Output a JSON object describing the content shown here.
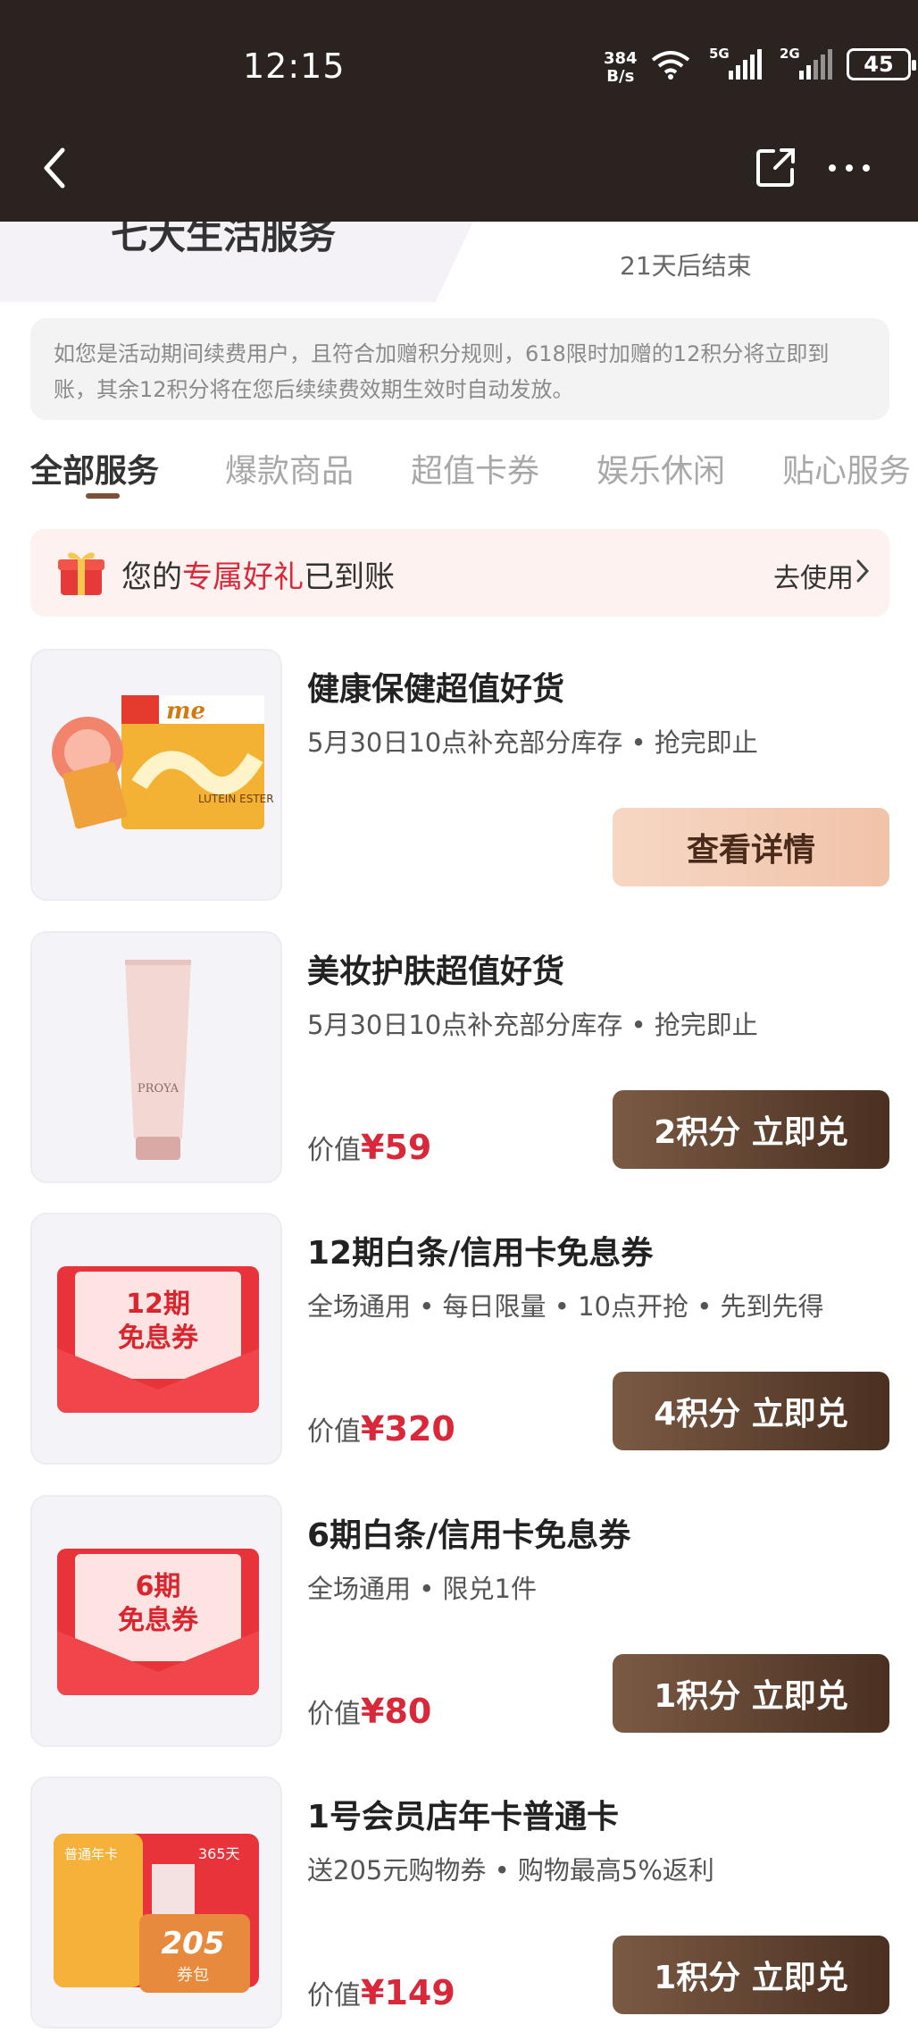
{
  "status_bar": {
    "time": "12:15",
    "net_speed_value": "384",
    "net_speed_unit": "B/s",
    "sim1_label": "5G",
    "sim2_label": "2G",
    "battery": "45"
  },
  "header": {
    "section_title": "七大生活服务",
    "countdown": "21天后结束"
  },
  "notice": "如您是活动期间续费用户，且符合加赠积分规则，618限时加赠的12积分将立即到账，其余12积分将在您后续续费效期生效时自动发放。",
  "tabs": [
    {
      "label": "全部服务"
    },
    {
      "label": "爆款商品"
    },
    {
      "label": "超值卡券"
    },
    {
      "label": "娱乐休闲"
    },
    {
      "label": "贴心服务"
    }
  ],
  "gift_banner": {
    "prefix": "您的",
    "highlight": "专属好礼",
    "suffix": "已到账",
    "action": "去使用"
  },
  "items": [
    {
      "title": "健康保健超值好货",
      "desc": "5月30日10点补充部分库存 • 抢完即止",
      "price_prefix": "",
      "price": "",
      "button": "查看详情"
    },
    {
      "title": "美妆护肤超值好货",
      "desc": "5月30日10点补充部分库存 • 抢完即止",
      "price_prefix": "价值",
      "price": "¥59",
      "button": "2积分 立即兑"
    },
    {
      "title": "12期白条/信用卡免息券",
      "desc": "全场通用 • 每日限量 • 10点开抢 • 先到先得",
      "price_prefix": "价值",
      "price": "¥320",
      "button": "4积分 立即兑"
    },
    {
      "title": "6期白条/信用卡免息券",
      "desc": "全场通用 • 限兑1件",
      "price_prefix": "价值",
      "price": "¥80",
      "button": "1积分 立即兑"
    },
    {
      "title": "1号会员店年卡普通卡",
      "desc": "送205元购物券 • 购物最高5%返利",
      "price_prefix": "价值",
      "price": "¥149",
      "button": "1积分 立即兑"
    }
  ],
  "thumbs": {
    "product1_brand": "me",
    "product1_box_text": "LUTEIN ESTER",
    "product2_brand": "PROYA",
    "coupon12_line1": "12期",
    "coupon12_line2": "免息券",
    "coupon6_line1": "6期",
    "coupon6_line2": "免息券",
    "card_label": "普通年卡",
    "card_days": "365天",
    "card_voucher": "205",
    "card_voucher_label": "券包"
  },
  "colors": {
    "topbar": "#2b2320",
    "accent_red": "#d8283a",
    "button_dark": "#5a3b2a",
    "button_light": "#f3cbb3"
  }
}
